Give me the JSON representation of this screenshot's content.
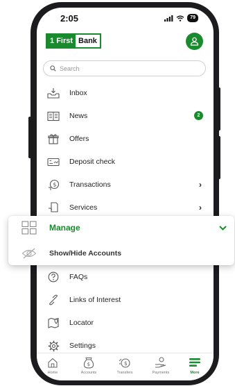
{
  "status_bar": {
    "time": "2:05",
    "battery": "79"
  },
  "brand": {
    "logo_num": "1",
    "logo_first": "First",
    "logo_bank": "Bank",
    "accent": "#1a8a2e"
  },
  "search": {
    "placeholder": "Search"
  },
  "menu": {
    "inbox": "Inbox",
    "news": "News",
    "news_badge": "2",
    "offers": "Offers",
    "deposit": "Deposit check",
    "transactions": "Transactions",
    "services": "Services",
    "faqs": "FAQs",
    "links": "Links of Interest",
    "locator": "Locator",
    "settings": "Settings"
  },
  "overlay": {
    "manage": "Manage",
    "show_hide": "Show/Hide Accounts"
  },
  "tabs": {
    "home": "Home",
    "accounts": "Accounts",
    "transfers": "Transfers",
    "payments": "Payments",
    "more": "More"
  }
}
